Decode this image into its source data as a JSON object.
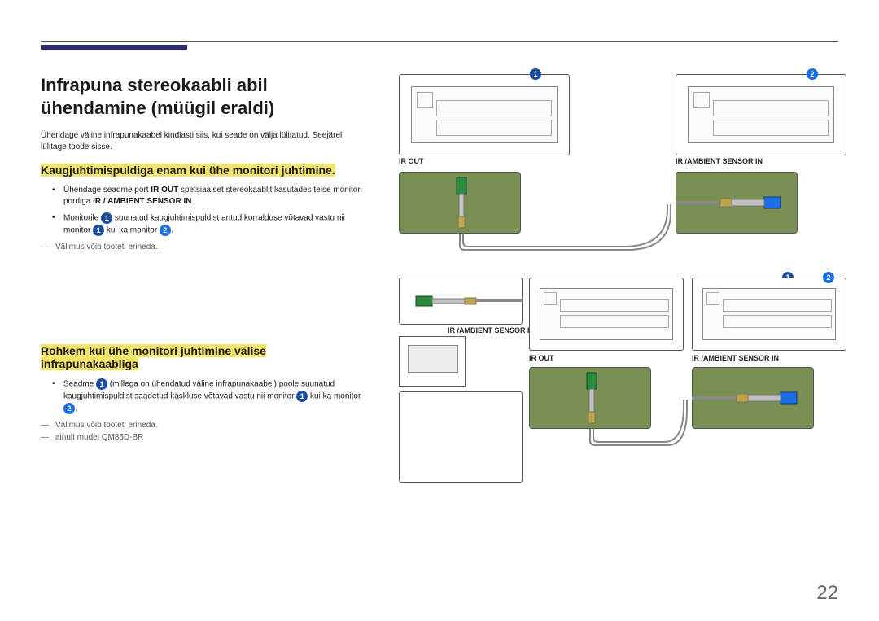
{
  "h1": "Infrapuna stereokaabli abil ühendamine (müügil eraldi)",
  "intro": "Ühendage väline infrapunakaabel kindlasti siis, kui seade on välja lülitatud. Seejärel lülitage toode sisse.",
  "section1": {
    "title": "Kaugjuhtimispuldiga enam kui ühe monitori juhtimine.",
    "bullet1_a": "Ühendage seadme port ",
    "bullet1_bold1": "IR OUT",
    "bullet1_b": " spetsiaalset stereokaablit kasutades teise monitori pordiga ",
    "bullet1_bold2": "IR / AMBIENT SENSOR IN",
    "bullet1_c": ".",
    "bullet2_a": "Monitorile ",
    "bullet2_b": " suunatud kaugjuhtimispuldist antud korralduse võtavad vastu nii monitor ",
    "bullet2_c": " kui ka monitor ",
    "bullet2_d": ".",
    "foot": "Välimus võib tooteti erineda."
  },
  "section2": {
    "title": "Rohkem kui ühe monitori juhtimine välise infrapunakaabliga",
    "bullet1_a": "Seadme ",
    "bullet1_b": " (millega on ühendatud väline infrapunakaabel) poole suunatud kaugjuhtimispuldist saadetud käskluse võtavad vastu nii monitor ",
    "bullet1_c": " kui ka monitor ",
    "bullet1_d": ".",
    "foot1": "Välimus võib tooteti erineda.",
    "foot2": "ainult mudel QM85D-BR"
  },
  "diagram": {
    "ir_out": "IR OUT",
    "ir_ambient": "IR /AMBIENT SENSOR IN"
  },
  "badges": {
    "n1": "1",
    "n2": "2"
  },
  "page_number": "22"
}
